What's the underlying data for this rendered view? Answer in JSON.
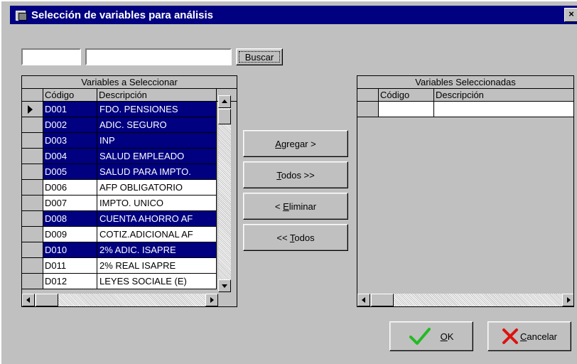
{
  "window": {
    "title": "Selección de variables para análisis",
    "close_label": "×"
  },
  "search": {
    "code_value": "",
    "desc_value": "",
    "button_label": "Buscar"
  },
  "left_grid": {
    "caption": "Variables a Seleccionar",
    "headers": [
      "Código",
      "Descripción"
    ],
    "rows": [
      {
        "code": "D001",
        "desc": "FDO. PENSIONES",
        "selected": true,
        "current": true
      },
      {
        "code": "D002",
        "desc": "ADIC. SEGURO",
        "selected": true
      },
      {
        "code": "D003",
        "desc": "INP",
        "selected": true
      },
      {
        "code": "D004",
        "desc": "SALUD EMPLEADO",
        "selected": true
      },
      {
        "code": "D005",
        "desc": "SALUD PARA IMPTO.",
        "selected": true
      },
      {
        "code": "D006",
        "desc": "AFP OBLIGATORIO",
        "selected": false
      },
      {
        "code": "D007",
        "desc": "IMPTO. UNICO",
        "selected": false
      },
      {
        "code": "D008",
        "desc": "CUENTA AHORRO AF",
        "selected": true
      },
      {
        "code": "D009",
        "desc": "COTIZ.ADICIONAL AF",
        "selected": false
      },
      {
        "code": "D010",
        "desc": "2% ADIC. ISAPRE",
        "selected": true
      },
      {
        "code": "D011",
        "desc": "2% REAL ISAPRE",
        "selected": false
      },
      {
        "code": "D012",
        "desc": "LEYES SOCIALE (E)",
        "selected": false
      }
    ]
  },
  "right_grid": {
    "caption": "Variables Seleccionadas",
    "headers": [
      "Código",
      "Descripción"
    ]
  },
  "actions": {
    "add": {
      "pre": "",
      "key": "A",
      "post": "gregar >"
    },
    "all": {
      "pre": "",
      "key": "T",
      "post": "odos >>"
    },
    "remove": {
      "pre": "< ",
      "key": "E",
      "post": "liminar"
    },
    "none": {
      "pre": "<< ",
      "key": "T",
      "post": "odos"
    }
  },
  "footer": {
    "ok": {
      "pre": "",
      "key": "O",
      "post": "K"
    },
    "cancel": {
      "pre": "",
      "key": "C",
      "post": "ancelar"
    }
  },
  "colors": {
    "highlight": "#000080",
    "face": "#c0c0c0",
    "ok_check": "#22bb22",
    "cancel_x": "#dd1111"
  }
}
